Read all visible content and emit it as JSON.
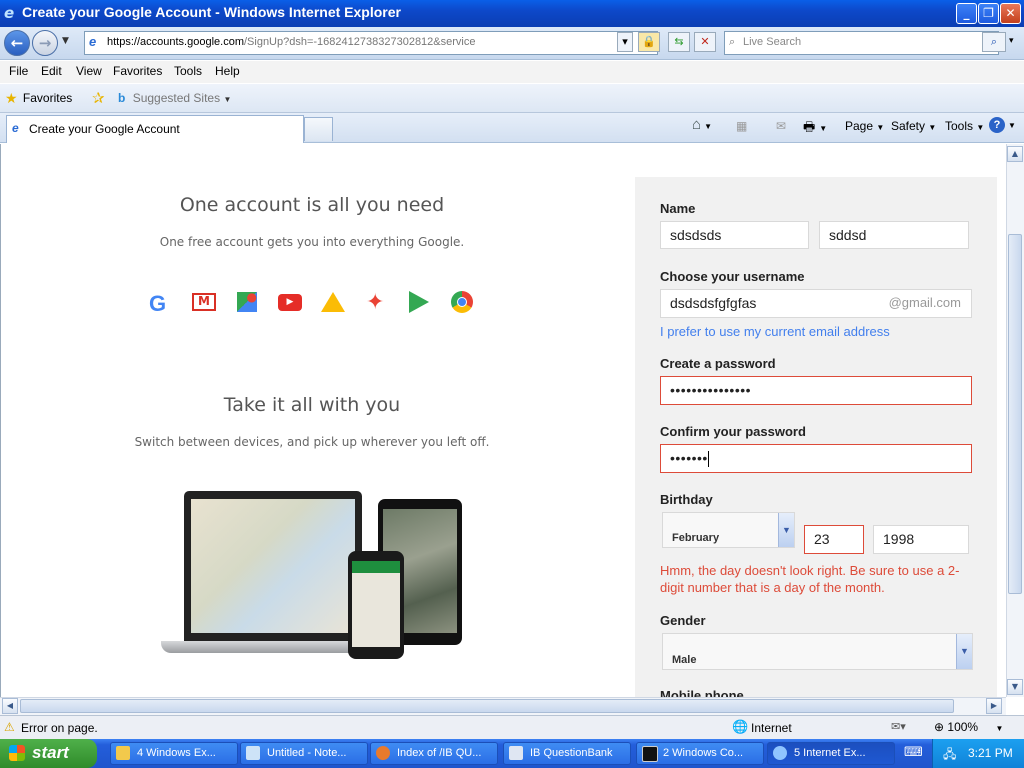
{
  "window": {
    "title": "Create your Google Account - Windows Internet Explorer"
  },
  "address": {
    "prefix": "https://accounts.",
    "domain": "google.com",
    "rest": "/SignUp?dsh=-1682412738327302812&service"
  },
  "search": {
    "placeholder": "Live Search"
  },
  "menu": [
    "File",
    "Edit",
    "View",
    "Favorites",
    "Tools",
    "Help"
  ],
  "favorites": {
    "label": "Favorites",
    "suggested": "Suggested Sites"
  },
  "tab": {
    "label": "Create your Google Account"
  },
  "commandbar": {
    "page": "Page",
    "safety": "Safety",
    "tools": "Tools"
  },
  "content": {
    "heading1": "One account is all you need",
    "sub1": "One free account gets you into everything Google.",
    "heading2": "Take it all with you",
    "sub2": "Switch between devices, and pick up wherever you left off.",
    "product_icons": [
      "google-g-icon",
      "gmail-icon",
      "maps-icon",
      "youtube-icon",
      "drive-icon",
      "photos-icon",
      "play-icon",
      "chrome-icon"
    ]
  },
  "form": {
    "name_label": "Name",
    "first_name": "sdsdsds",
    "last_name": "sddsd",
    "username_label": "Choose your username",
    "username": "dsdsdsfgfgfas",
    "username_suffix": "@gmail.com",
    "use_email_link": "I prefer to use my current email address",
    "password_label": "Create a password",
    "password": "•••••••••••••••",
    "confirm_label": "Confirm your password",
    "confirm": "•••••••",
    "birthday_label": "Birthday",
    "birth_month": "February",
    "birth_day": "23",
    "birth_year": "1998",
    "birthday_error": "Hmm, the day doesn't look right. Be sure to use a 2-digit number that is a day of the month.",
    "gender_label": "Gender",
    "gender": "Male",
    "mobile_label": "Mobile phone"
  },
  "status": {
    "error": "Error on page.",
    "zone": "Internet",
    "zoom": "100%"
  },
  "taskbar": {
    "start": "start",
    "tasks": [
      "4 Windows Ex...",
      "Untitled - Note...",
      "Index of /IB QU...",
      "IB QuestionBank",
      "2 Windows Co...",
      "5 Internet Ex..."
    ],
    "clock": "3:21 PM"
  },
  "colors": {
    "error": "#dd4b39",
    "link": "#427fed",
    "titlebar": "#0b4fd6"
  }
}
